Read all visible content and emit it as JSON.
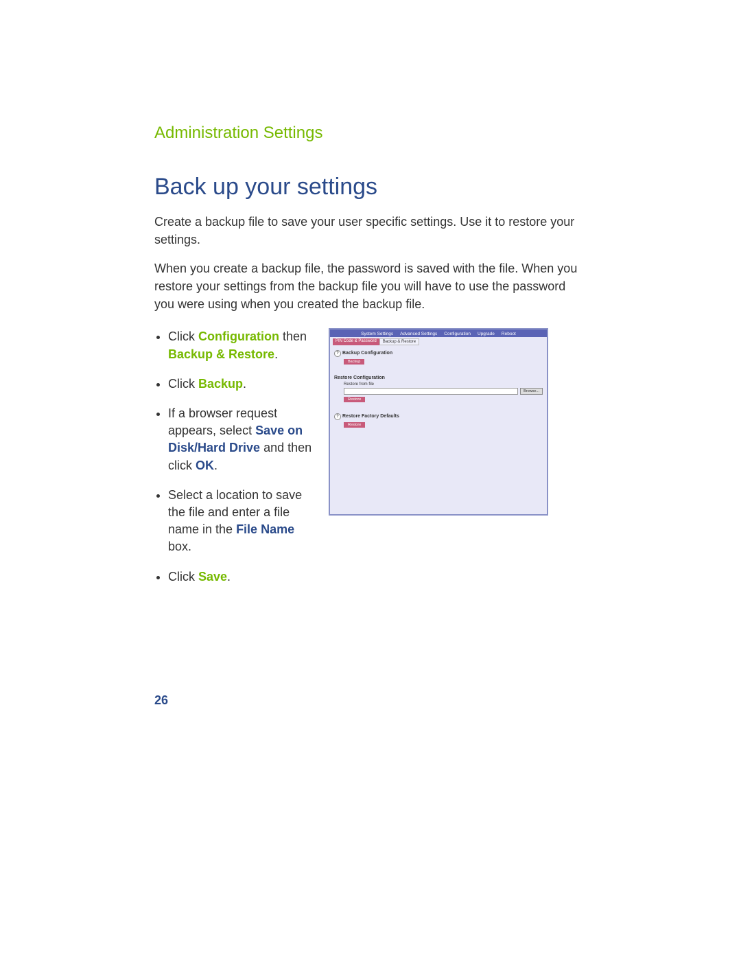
{
  "breadcrumb": "Administration Settings",
  "title": "Back up your settings",
  "intro1": "Create a backup file to save your user specific settings. Use it to restore your settings.",
  "intro2": "When you create a backup file, the password is saved with the file. When you restore your settings from the backup file you will have to use the password you were using when you created the backup file.",
  "steps": {
    "s1_pre": "Click ",
    "s1_conf": "Configuration",
    "s1_mid": " then ",
    "s1_bk": "Backup & Restore",
    "s1_post": ".",
    "s2_pre": "Click ",
    "s2_b": "Backup",
    "s2_post": ".",
    "s3_pre": "If a browser request appears, select ",
    "s3_save": "Save on Disk/Hard Drive",
    "s3_mid": " and then click ",
    "s3_ok": "OK",
    "s3_post": ".",
    "s4_pre": "Select a location to save the file and enter a file name in the ",
    "s4_fn": "File Name",
    "s4_post": " box.",
    "s5_pre": "Click ",
    "s5_save": "Save",
    "s5_post": "."
  },
  "shot": {
    "tabs": {
      "t1": "System Settings",
      "t2": "Advanced Settings",
      "t3": "Configuration",
      "t4": "Upgrade",
      "t5": "Reboot"
    },
    "subtabs": {
      "st1": "PIN Code & Password",
      "st2": "Backup & Restore"
    },
    "h1": "Backup Configuration",
    "btn_backup": "Backup",
    "h2": "Restore Configuration",
    "label_restore": "Restore from file",
    "btn_browse": "Browse...",
    "btn_restore": "Restore",
    "h3": "Restore Factory Defaults",
    "btn_restore2": "Restore"
  },
  "page_number": "26"
}
